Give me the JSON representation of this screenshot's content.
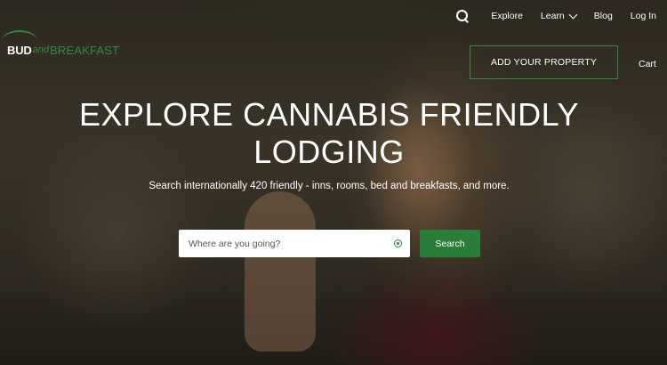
{
  "brand": {
    "part1": "BUD",
    "part2": "and",
    "part3": "BREAKFAST",
    "accent": "#2e8b3e"
  },
  "nav": {
    "search_icon": "search-icon",
    "items": [
      {
        "label": "Explore"
      },
      {
        "label": "Learn"
      },
      {
        "label": "Blog"
      },
      {
        "label": "Log In"
      }
    ],
    "add_property": "ADD YOUR PROPERTY",
    "cart": "Cart"
  },
  "hero": {
    "title_line1": "EXPLORE CANNABIS FRIENDLY",
    "title_line2": "LODGING",
    "subtitle": "Search internationally 420 friendly - inns, rooms, bed and breakfasts, and more."
  },
  "search": {
    "placeholder": "Where are you going?",
    "value": "",
    "button": "Search",
    "location_icon": "location-target-icon",
    "button_color": "#2b7d3a"
  }
}
